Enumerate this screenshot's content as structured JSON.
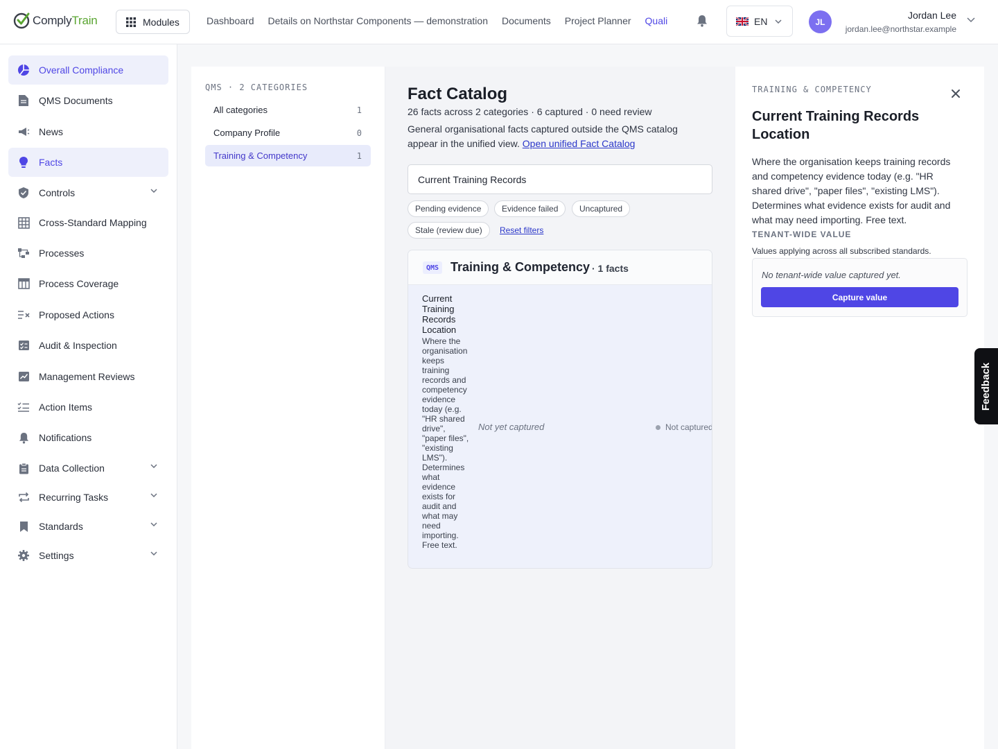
{
  "app": {
    "logo_part1": "Comply",
    "logo_part2": "Train",
    "modules_label": "Modules"
  },
  "topnav": {
    "items": [
      "Dashboard",
      "Details on Northstar Components — demonstration",
      "Documents",
      "Project Planner",
      "Quali"
    ]
  },
  "language": {
    "code": "EN"
  },
  "user": {
    "initials": "JL",
    "name": "Jordan Lee",
    "email": "jordan.lee@northstar.example"
  },
  "sidebar": {
    "items": [
      {
        "label": "Overall Compliance",
        "icon": "pie-chart-icon"
      },
      {
        "label": "QMS Documents",
        "icon": "document-icon"
      },
      {
        "label": "News",
        "icon": "megaphone-icon"
      },
      {
        "label": "Facts",
        "icon": "lightbulb-icon"
      },
      {
        "label": "Controls",
        "icon": "shield-check-icon"
      },
      {
        "label": "Cross-Standard Mapping",
        "icon": "grid-table-icon"
      },
      {
        "label": "Processes",
        "icon": "flow-icon"
      },
      {
        "label": "Process Coverage",
        "icon": "table-icon"
      },
      {
        "label": "Proposed Actions",
        "icon": "list-x-icon"
      },
      {
        "label": "Audit & Inspection",
        "icon": "checklist-icon"
      },
      {
        "label": "Management Reviews",
        "icon": "chart-review-icon"
      },
      {
        "label": "Action Items",
        "icon": "list-check-icon"
      },
      {
        "label": "Notifications",
        "icon": "bell-icon"
      },
      {
        "label": "Data Collection",
        "icon": "clipboard-icon"
      },
      {
        "label": "Recurring Tasks",
        "icon": "repeat-icon"
      },
      {
        "label": "Standards",
        "icon": "bookmark-icon"
      },
      {
        "label": "Settings",
        "icon": "gear-icon"
      }
    ]
  },
  "categories": {
    "heading": "QMS · 2 CATEGORIES",
    "items": [
      {
        "label": "All categories",
        "count": "1"
      },
      {
        "label": "Company Profile",
        "count": "0"
      },
      {
        "label": "Training & Competency",
        "count": "1"
      }
    ]
  },
  "catalog": {
    "title": "Fact Catalog",
    "stats": "26 facts across 2 categories · 6 captured · 0 need review",
    "desc": "General organisational facts captured outside the QMS catalog appear in the unified view.",
    "link": "Open unified Fact Catalog",
    "search_value": "Current Training Records",
    "filters": [
      "Pending evidence",
      "Evidence failed",
      "Uncaptured",
      "Stale (review due)"
    ],
    "reset_label": "Reset filters"
  },
  "group": {
    "badge": "QMS",
    "title": "Training & Competency",
    "count": "· 1 facts",
    "fact": {
      "name": "Current Training Records Location",
      "desc": "Where the organisation keeps training records and competency evidence today (e.g. \"HR shared drive\", \"paper files\", \"existing LMS\"). Determines what evidence exists for audit and what may need importing. Free text.",
      "value": "Not yet captured",
      "status": "Not captured"
    }
  },
  "detail": {
    "eyebrow": "TRAINING & COMPETENCY",
    "title": "Current Training Records Location",
    "desc": "Where the organisation keeps training records and competency evidence today (e.g. \"HR shared drive\", \"paper files\", \"existing LMS\"). Determines what evidence exists for audit and what may need importing. Free text.",
    "value_label": "TENANT-WIDE VALUE",
    "value_sub": "Values applying across all subscribed standards.",
    "empty_text": "No tenant-wide value captured yet.",
    "capture_label": "Capture value"
  },
  "feedback": {
    "label": "Feedback"
  },
  "colors": {
    "accent": "#4f46e5",
    "brand_green": "#5aa531",
    "active_bg": "#eef0fb"
  }
}
